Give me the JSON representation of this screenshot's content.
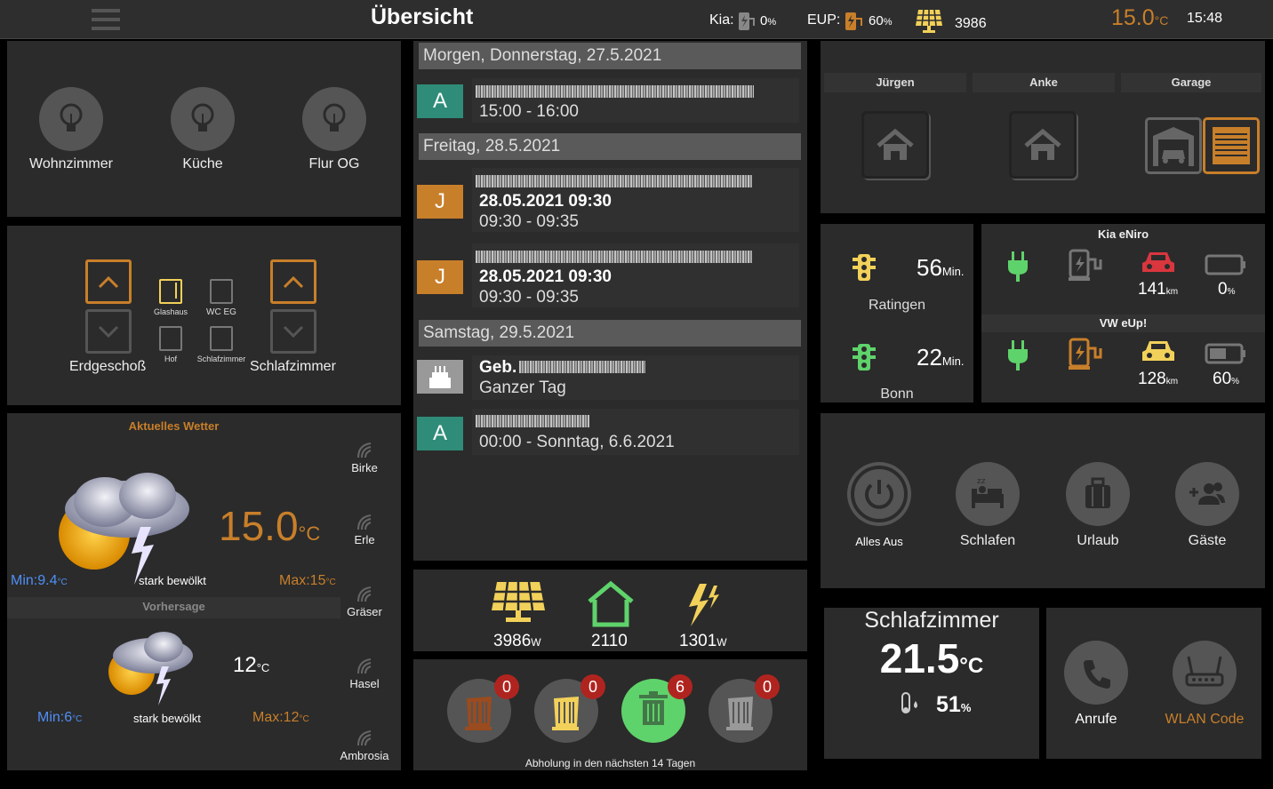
{
  "header": {
    "title": "Übersicht",
    "kia_label": "Kia:",
    "kia_value": "0",
    "kia_unit": "%",
    "eup_label": "EUP:",
    "eup_value": "60",
    "eup_unit": "%",
    "solar_value": "3986",
    "temp_value": "15.0",
    "temp_unit": "°C",
    "time": "15:48"
  },
  "lights": [
    {
      "label": "Wohnzimmer"
    },
    {
      "label": "Küche"
    },
    {
      "label": "Flur OG"
    }
  ],
  "shutters": {
    "left_label": "Erdgeschoß",
    "right_label": "Schlafzimmer",
    "windows": [
      "Glashaus",
      "WC EG",
      "Hof",
      "Schlafzimmer"
    ]
  },
  "weather": {
    "current_title": "Aktuelles Wetter",
    "current_temp": "15.0",
    "temp_unit": "°C",
    "current_min_label": "Min:9.4",
    "current_max_label": "Max:15",
    "current_desc": "stark bewölkt",
    "forecast_title": "Vorhersage",
    "forecast_temp": "12",
    "forecast_min_label": "Min:6",
    "forecast_max_label": "Max:12",
    "forecast_desc": "stark bewölkt",
    "pollen": [
      "Birke",
      "Erle",
      "Gräser",
      "Hasel",
      "Ambrosia"
    ]
  },
  "calendar": {
    "groups": [
      {
        "date": "Morgen, Donnerstag, 27.5.2021"
      },
      {
        "date": "Freitag, 28.5.2021"
      },
      {
        "date": "Samstag, 29.5.2021"
      }
    ],
    "events": [
      {
        "badge": "A",
        "title": "",
        "time": "15:00 - 16:00"
      },
      {
        "badge": "J",
        "title": "28.05.2021 09:30",
        "time": "09:30 - 09:35"
      },
      {
        "badge": "J",
        "title": "28.05.2021 09:30",
        "time": "09:30 - 09:35"
      },
      {
        "badge": "",
        "title": "Geb.",
        "time": "Ganzer Tag"
      },
      {
        "badge": "A",
        "title": "",
        "time": "00:00 - Sonntag, 6.6.2021"
      }
    ]
  },
  "energy": {
    "solar": "3986",
    "solar_unit": "W",
    "house": "2110",
    "grid": "1301",
    "grid_unit": "W"
  },
  "waste": {
    "counts": [
      "0",
      "0",
      "6",
      "0"
    ],
    "caption": "Abholung in den nächsten 14 Tagen"
  },
  "presence": {
    "names": [
      "Jürgen",
      "Anke",
      "Garage"
    ]
  },
  "traffic": {
    "routes": [
      {
        "minutes": "56",
        "unit": "Min.",
        "label": "Ratingen"
      },
      {
        "minutes": "22",
        "unit": "Min.",
        "label": "Bonn"
      }
    ]
  },
  "cars": [
    {
      "name": "Kia eNiro",
      "range": "141",
      "range_unit": "km",
      "battery": "0",
      "battery_unit": "%"
    },
    {
      "name": "VW eUp!",
      "range": "128",
      "range_unit": "km",
      "battery": "60",
      "battery_unit": "%"
    }
  ],
  "scenes": [
    {
      "label": "Alles Aus"
    },
    {
      "label": "Schlafen"
    },
    {
      "label": "Urlaub"
    },
    {
      "label": "Gäste"
    }
  ],
  "room": {
    "name": "Schlafzimmer",
    "temp": "21.5",
    "temp_unit": "°C",
    "humidity": "51",
    "humidity_unit": "%"
  },
  "actions": [
    {
      "label": "Anrufe"
    },
    {
      "label": "WLAN Code"
    }
  ],
  "colors": {
    "accent_orange": "#c87f2a",
    "teal": "#2e8c78",
    "green": "#5fd36b",
    "yellow": "#f2d15a",
    "red": "#d9363e",
    "blue": "#4f8ff7"
  }
}
